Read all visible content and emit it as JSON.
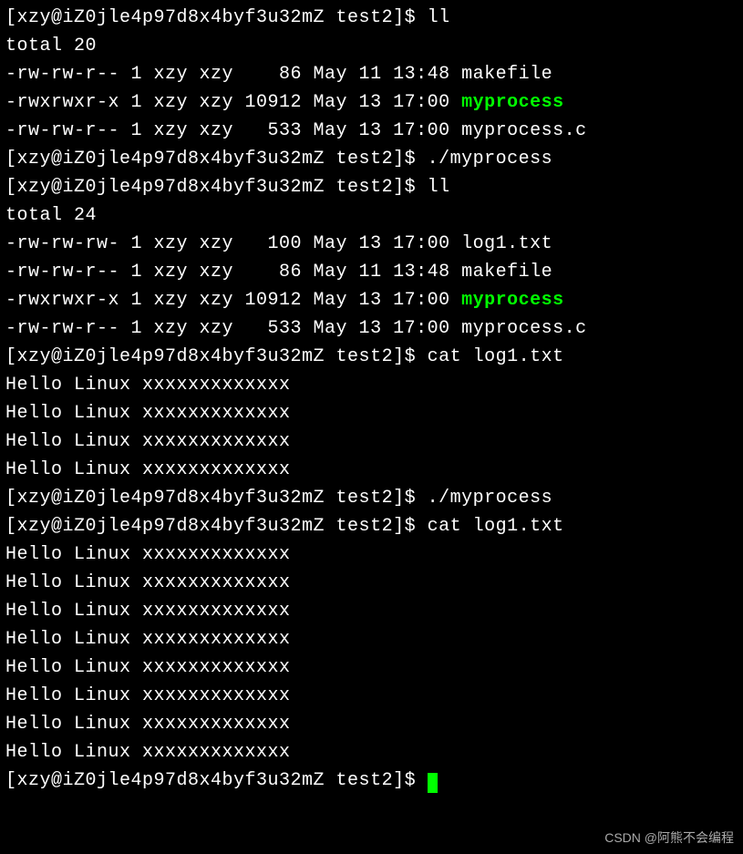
{
  "prompt_user": "xzy",
  "prompt_host": "iZ0jle4p97d8x4byf3u32mZ",
  "prompt_dir": "test2",
  "prompt_prefix": "[xzy@iZ0jle4p97d8x4byf3u32mZ test2]$ ",
  "commands": {
    "ll": "ll",
    "run_myprocess": "./myprocess",
    "cat_log": "cat log1.txt"
  },
  "listing1": {
    "total": "total 20",
    "rows": [
      {
        "perm": "-rw-rw-r--",
        "links": "1",
        "user": "xzy",
        "group": "xzy",
        "size": "86",
        "date": "May 11 13:48",
        "name": "makefile",
        "exec": false
      },
      {
        "perm": "-rwxrwxr-x",
        "links": "1",
        "user": "xzy",
        "group": "xzy",
        "size": "10912",
        "date": "May 13 17:00",
        "name": "myprocess",
        "exec": true
      },
      {
        "perm": "-rw-rw-r--",
        "links": "1",
        "user": "xzy",
        "group": "xzy",
        "size": "533",
        "date": "May 13 17:00",
        "name": "myprocess.c",
        "exec": false
      }
    ]
  },
  "listing2": {
    "total": "total 24",
    "rows": [
      {
        "perm": "-rw-rw-rw-",
        "links": "1",
        "user": "xzy",
        "group": "xzy",
        "size": "100",
        "date": "May 13 17:00",
        "name": "log1.txt",
        "exec": false
      },
      {
        "perm": "-rw-rw-r--",
        "links": "1",
        "user": "xzy",
        "group": "xzy",
        "size": "86",
        "date": "May 11 13:48",
        "name": "makefile",
        "exec": false
      },
      {
        "perm": "-rwxrwxr-x",
        "links": "1",
        "user": "xzy",
        "group": "xzy",
        "size": "10912",
        "date": "May 13 17:00",
        "name": "myprocess",
        "exec": true
      },
      {
        "perm": "-rw-rw-r--",
        "links": "1",
        "user": "xzy",
        "group": "xzy",
        "size": "533",
        "date": "May 13 17:00",
        "name": "myprocess.c",
        "exec": false
      }
    ]
  },
  "hello_line": "Hello Linux xxxxxxxxxxxxx",
  "cat1_count": 4,
  "cat2_count": 8,
  "watermark": "CSDN @阿熊不会编程"
}
